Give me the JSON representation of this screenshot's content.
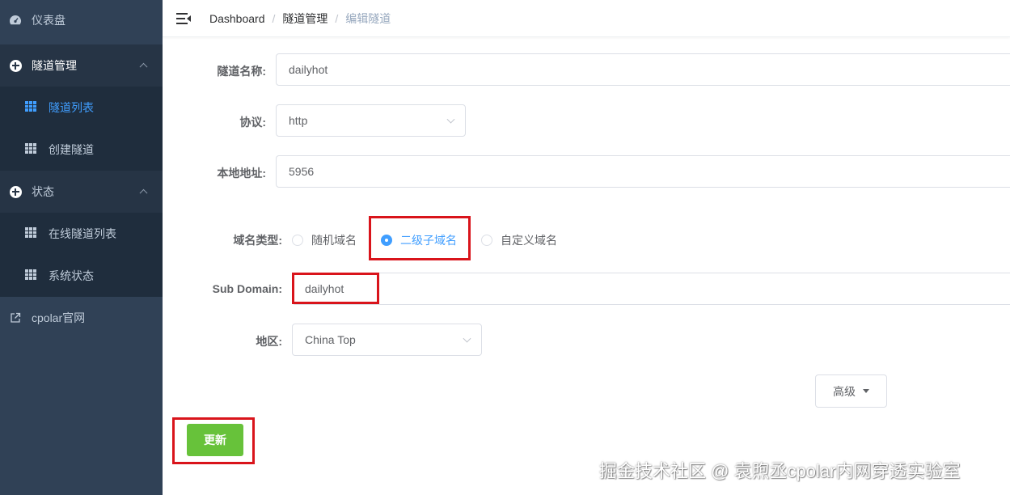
{
  "sidebar": {
    "dashboard": "仪表盘",
    "tunnel_management": "隧道管理",
    "tunnel_list": "隧道列表",
    "create_tunnel": "创建隧道",
    "status": "状态",
    "online_tunnel_list": "在线隧道列表",
    "system_status": "系统状态",
    "cpolar_site": "cpolar官网"
  },
  "breadcrumb": {
    "home": "Dashboard",
    "parent": "隧道管理",
    "current": "编辑隧道",
    "separator": "/"
  },
  "form": {
    "tunnel_name_label": "隧道名称:",
    "tunnel_name_value": "dailyhot",
    "protocol_label": "协议:",
    "protocol_value": "http",
    "local_address_label": "本地地址:",
    "local_address_value": "5956",
    "domain_type_label": "域名类型:",
    "domain_type_options": [
      "随机域名",
      "二级子域名",
      "自定义域名"
    ],
    "domain_type_selected": "二级子域名",
    "subdomain_label": "Sub Domain:",
    "subdomain_value": "dailyhot",
    "region_label": "地区:",
    "region_value": "China Top",
    "advanced_button": "高级",
    "update_button": "更新"
  },
  "watermark": "掘金技术社区 @ 袁煦丞cpolar内网穿透实验室",
  "colors": {
    "sidebar_bg": "#304156",
    "submenu_bg": "#1f2d3d",
    "active": "#409eff",
    "success": "#67c23a",
    "highlight": "#d9141b"
  }
}
